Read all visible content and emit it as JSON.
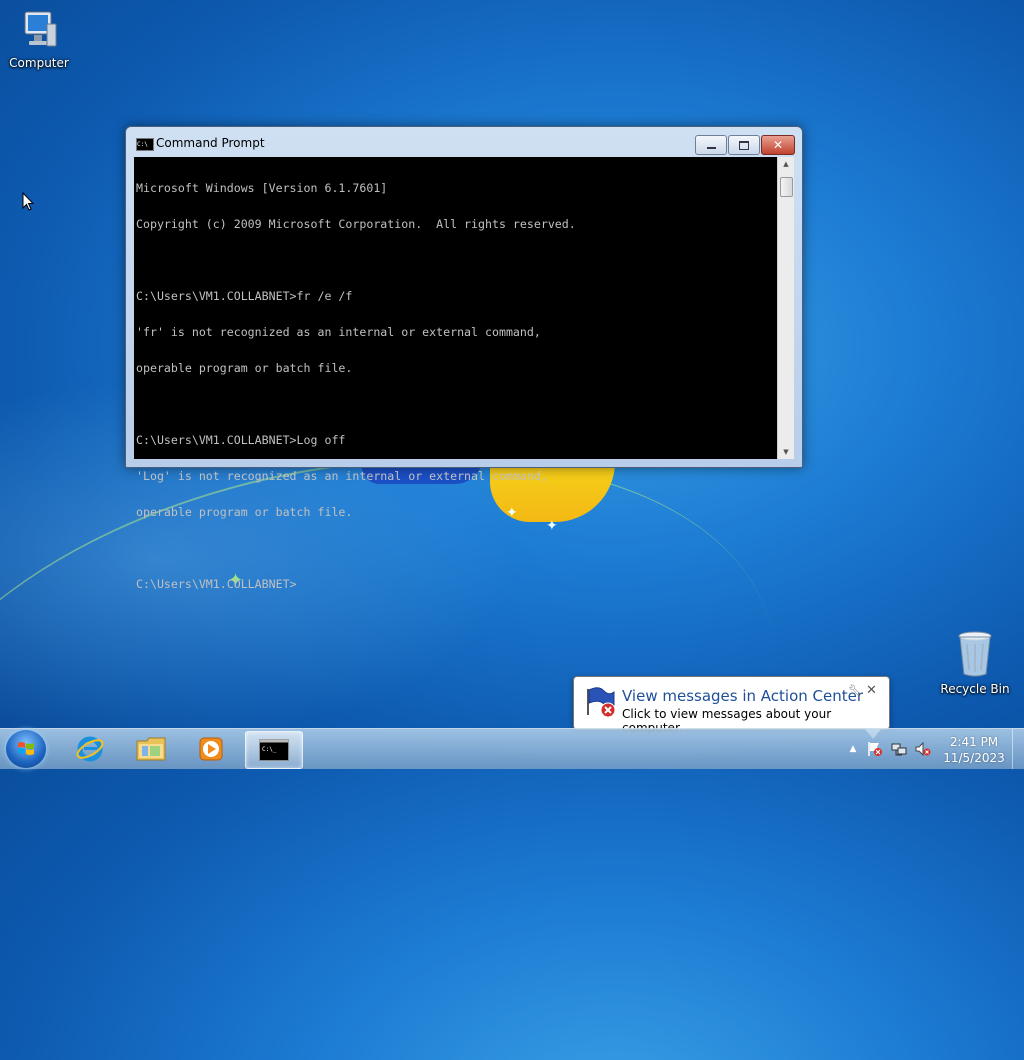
{
  "desktop": {
    "icons": [
      {
        "label": "Computer",
        "icon": "computer-icon"
      },
      {
        "label": "Recycle Bin",
        "icon": "recycle-bin-icon"
      }
    ]
  },
  "cmd_window": {
    "title": "Command Prompt",
    "icon": "cmd-icon",
    "lines": [
      "Microsoft Windows [Version 6.1.7601]",
      "Copyright (c) 2009 Microsoft Corporation.  All rights reserved.",
      "",
      "C:\\Users\\VM1.COLLABNET>fr /e /f",
      "'fr' is not recognized as an internal or external command,",
      "operable program or batch file.",
      "",
      "C:\\Users\\VM1.COLLABNET>Log off",
      "'Log' is not recognized as an internal or external command,",
      "operable program or batch file.",
      "",
      "C:\\Users\\VM1.COLLABNET>"
    ],
    "buttons": {
      "minimize": "minimize-icon",
      "maximize": "maximize-icon",
      "close": "close-icon"
    }
  },
  "notification": {
    "title": "View messages in Action Center",
    "body": "Click to view messages about your computer.",
    "icon": "action-center-flag-icon"
  },
  "taskbar": {
    "pinned": [
      {
        "name": "internet-explorer",
        "icon": "internet-explorer-icon"
      },
      {
        "name": "windows-explorer",
        "icon": "folder-icon"
      },
      {
        "name": "media-player",
        "icon": "media-player-icon"
      },
      {
        "name": "command-prompt",
        "icon": "cmd-icon",
        "active": true
      }
    ],
    "tray": {
      "icons": [
        "show-hidden-icons-icon",
        "action-center-icon",
        "network-icon",
        "volume-muted-icon"
      ]
    },
    "clock": {
      "time": "2:41 PM",
      "date": "11/5/2023"
    }
  },
  "colors": {
    "console_bg": "#000000",
    "console_text": "#c0c0c0",
    "notification_title": "#1f4f9b"
  }
}
